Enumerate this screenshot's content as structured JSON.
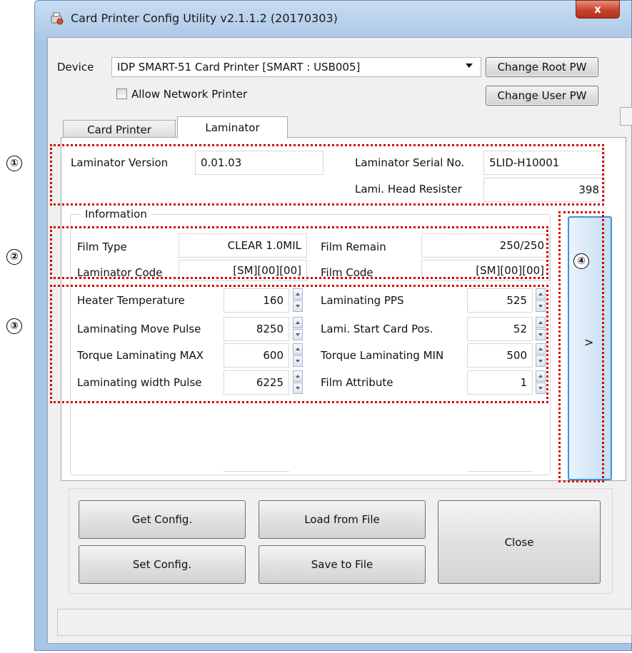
{
  "window": {
    "title": "Card Printer Config Utility v2.1.1.2 (20170303)",
    "close_label": "x"
  },
  "device": {
    "label": "Device",
    "selected": "IDP SMART-51 Card Printer  [SMART : USB005]",
    "change_root_pw": "Change Root PW",
    "change_user_pw": "Change User PW",
    "allow_network_label": "Allow Network Printer"
  },
  "tabs": [
    {
      "label": "Card Printer"
    },
    {
      "label": "Laminator"
    }
  ],
  "lam_info": {
    "version_label": "Laminator Version",
    "version_value": "0.01.03",
    "serial_label": "Laminator Serial No.",
    "serial_value": "5LID-H10001",
    "head_label": "Lami. Head Resister",
    "head_value": "398"
  },
  "information": {
    "group_label": "Information",
    "film_type_label": "Film Type",
    "film_type_value": "CLEAR 1.0MIL",
    "film_remain_label": "Film Remain",
    "film_remain_value": "250/250",
    "lam_code_label": "Laminator Code",
    "lam_code_value": "[SM][00][00]",
    "film_code_label": "Film Code",
    "film_code_value": "[SM][00][00]"
  },
  "params": {
    "heater_temp_label": "Heater Temperature",
    "heater_temp_value": "160",
    "lam_pps_label": "Laminating PPS",
    "lam_pps_value": "525",
    "move_pulse_label": "Laminating Move Pulse",
    "move_pulse_value": "8250",
    "start_card_label": "Lami. Start Card Pos.",
    "start_card_value": "52",
    "torque_max_label": "Torque Laminating MAX",
    "torque_max_value": "600",
    "torque_min_label": "Torque Laminating MIN",
    "torque_min_value": "500",
    "width_pulse_label": "Laminating width Pulse",
    "width_pulse_value": "6225",
    "film_attr_label": "Film Attribute",
    "film_attr_value": "1"
  },
  "side_button": {
    "label": ">"
  },
  "buttons": {
    "get_config": "Get Config.",
    "set_config": "Set Config.",
    "load_file": "Load from File",
    "save_file": "Save to File",
    "close": "Close"
  },
  "annotations": {
    "n1": "①",
    "n2": "②",
    "n3": "③",
    "n4": "④"
  },
  "colors": {
    "annotation_red": "#d40000",
    "close_red": "#c8432b",
    "side_button_border": "#3d95d8"
  }
}
